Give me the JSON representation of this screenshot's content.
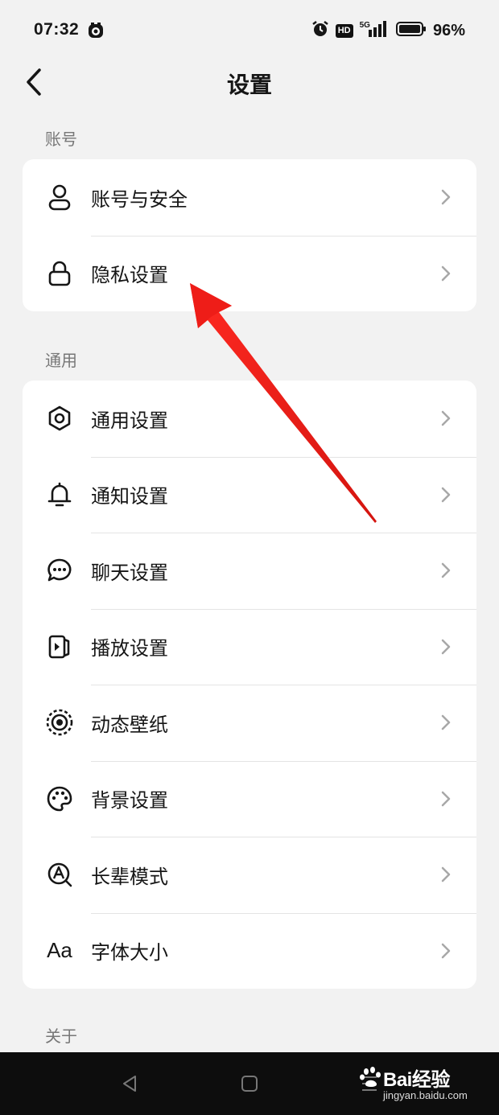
{
  "status_bar": {
    "time": "07:32",
    "hd_label": "HD",
    "network_label": "5G",
    "battery_percent": "96%",
    "icons": [
      "notification-icon",
      "alarm-icon",
      "hd-icon",
      "signal-icon",
      "battery-icon"
    ]
  },
  "header": {
    "title": "设置",
    "back_icon": "chevron-left-icon"
  },
  "sections": {
    "account": {
      "header": "账号",
      "items": [
        {
          "label": "账号与安全",
          "icon": "user-icon"
        },
        {
          "label": "隐私设置",
          "icon": "lock-icon"
        }
      ]
    },
    "general": {
      "header": "通用",
      "items": [
        {
          "label": "通用设置",
          "icon": "gear-icon"
        },
        {
          "label": "通知设置",
          "icon": "bell-icon"
        },
        {
          "label": "聊天设置",
          "icon": "chat-bubble-icon"
        },
        {
          "label": "播放设置",
          "icon": "play-icon"
        },
        {
          "label": "动态壁纸",
          "icon": "wallpaper-icon"
        },
        {
          "label": "背景设置",
          "icon": "palette-icon"
        },
        {
          "label": "长辈模式",
          "icon": "elder-mode-icon"
        },
        {
          "label": "字体大小",
          "icon": "font-size-icon",
          "glyph": "Aa"
        }
      ]
    },
    "about": {
      "header": "关于"
    }
  },
  "annotation": {
    "type": "red-arrow",
    "color": "#e8231f",
    "points_to": "隐私设置"
  },
  "watermark": {
    "brand": "Bai经验",
    "url": "jingyan.baidu.com"
  },
  "colors": {
    "background": "#f2f2f2",
    "card": "#ffffff",
    "text": "#161616",
    "section_header": "#777777",
    "chevron": "#a8a8a8",
    "nav_bar": "#0d0d0d"
  }
}
